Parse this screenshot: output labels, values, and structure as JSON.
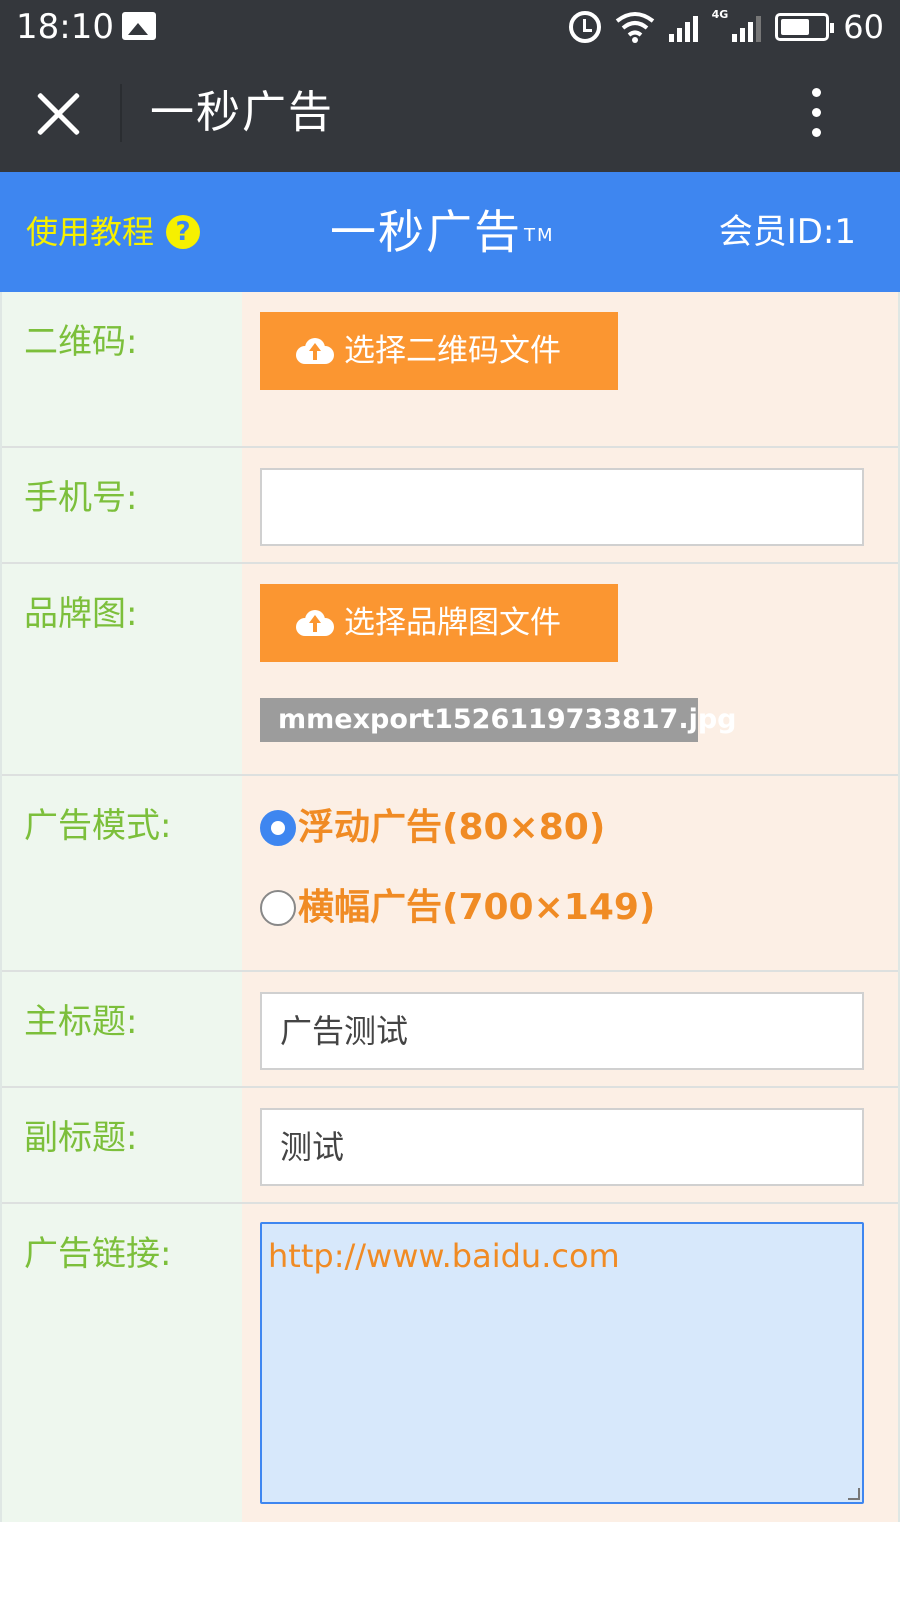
{
  "status_bar": {
    "time": "18:10",
    "network": "4G",
    "battery_level": "60"
  },
  "title_bar": {
    "title": "一秒广告"
  },
  "header": {
    "tutorial_label": "使用教程",
    "help_glyph": "?",
    "brand": "一秒广告",
    "brand_mark": "TM",
    "member_id": "会员ID:1",
    "accent_color": "#3e86f0",
    "tutorial_color": "#f6f000"
  },
  "form": {
    "qrcode": {
      "label": "二维码:",
      "button": "选择二维码文件"
    },
    "phone": {
      "label": "手机号:",
      "value": ""
    },
    "brand_image": {
      "label": "品牌图:",
      "button": "选择品牌图文件",
      "filename": "mmexport1526119733817.jpg"
    },
    "ad_mode": {
      "label": "广告模式:",
      "options": [
        {
          "label": "浮动广告(80×80)",
          "selected": true
        },
        {
          "label": "横幅广告(700×149)",
          "selected": false
        }
      ]
    },
    "main_title": {
      "label": "主标题:",
      "value": "广告测试"
    },
    "subtitle": {
      "label": "副标题:",
      "value": "测试"
    },
    "ad_link": {
      "label": "广告链接:",
      "value": "http://www.baidu.com"
    },
    "label_color": "#7cbf3b",
    "button_color": "#fb9631"
  }
}
